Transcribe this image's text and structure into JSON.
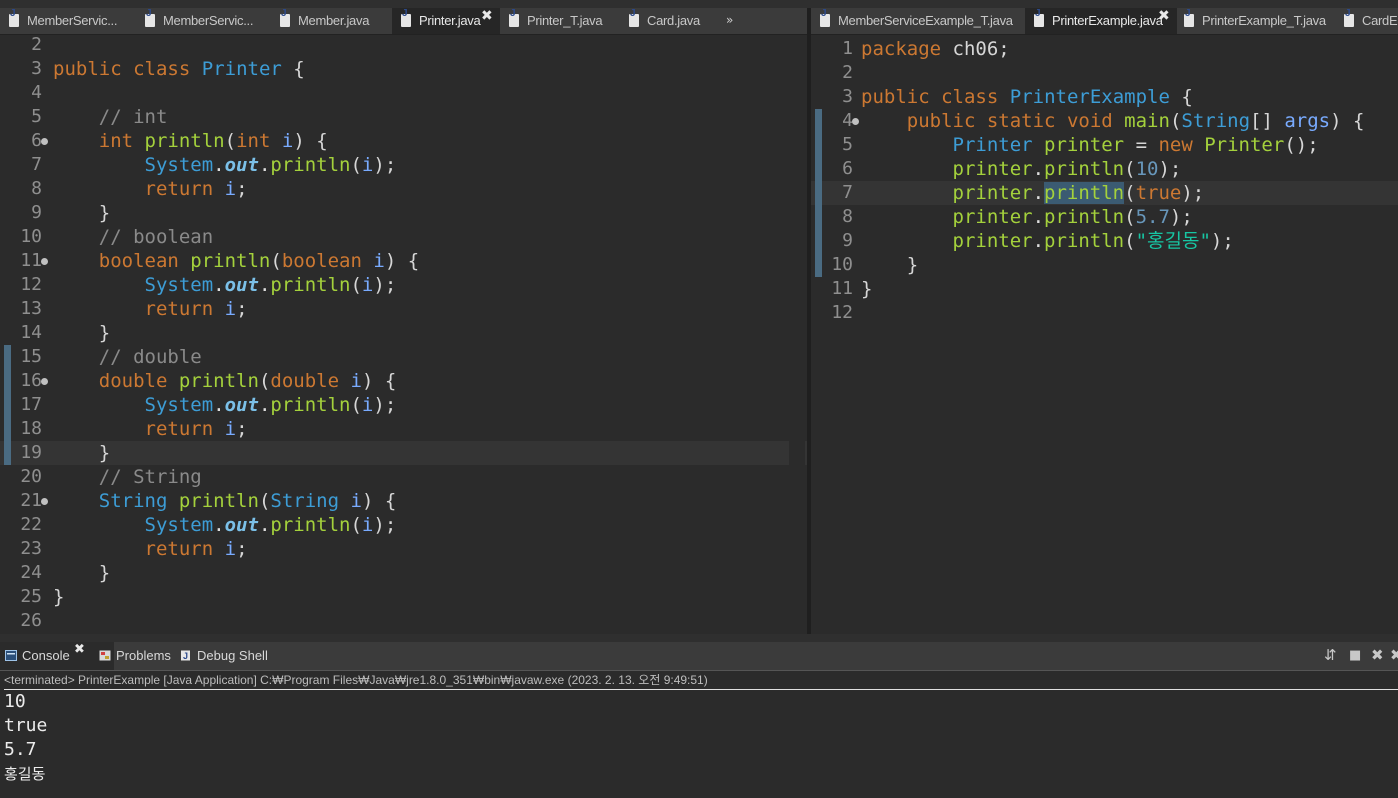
{
  "left_tabs": [
    {
      "label": "MemberServic...",
      "active": false
    },
    {
      "label": "MemberServic...",
      "active": false
    },
    {
      "label": "Member.java",
      "active": false
    },
    {
      "label": "Printer.java",
      "active": true
    },
    {
      "label": "Printer_T.java",
      "active": false
    },
    {
      "label": "Card.java",
      "active": false
    }
  ],
  "left_overflow": "»",
  "right_tabs": [
    {
      "label": "MemberServiceExample_T.java",
      "active": false
    },
    {
      "label": "PrinterExample.java",
      "active": true
    },
    {
      "label": "PrinterExample_T.java",
      "active": false
    },
    {
      "label": "CardE",
      "active": false
    }
  ],
  "close_glyph": "✖",
  "left_editor": {
    "lines": [
      {
        "n": "2",
        "tokens": []
      },
      {
        "n": "3",
        "tokens": [
          [
            "kw",
            "public"
          ],
          [
            "plain",
            " "
          ],
          [
            "kw",
            "class"
          ],
          [
            "plain",
            " "
          ],
          [
            "ty",
            "Printer"
          ],
          [
            "plain",
            " {"
          ]
        ]
      },
      {
        "n": "4",
        "tokens": []
      },
      {
        "n": "5",
        "tokens": [
          [
            "plain",
            "    "
          ],
          [
            "cm",
            "// int"
          ]
        ]
      },
      {
        "n": "6",
        "fold": true,
        "tokens": [
          [
            "plain",
            "    "
          ],
          [
            "kw",
            "int"
          ],
          [
            "plain",
            " "
          ],
          [
            "fn",
            "println"
          ],
          [
            "plain",
            "("
          ],
          [
            "kw",
            "int"
          ],
          [
            "plain",
            " "
          ],
          [
            "va",
            "i"
          ],
          [
            "plain",
            ") {"
          ]
        ]
      },
      {
        "n": "7",
        "tokens": [
          [
            "plain",
            "        "
          ],
          [
            "ty",
            "System"
          ],
          [
            "dot",
            "."
          ],
          [
            "fld",
            "out"
          ],
          [
            "dot",
            "."
          ],
          [
            "fn",
            "println"
          ],
          [
            "plain",
            "("
          ],
          [
            "va",
            "i"
          ],
          [
            "plain",
            ");"
          ]
        ]
      },
      {
        "n": "8",
        "tokens": [
          [
            "plain",
            "        "
          ],
          [
            "kw",
            "return"
          ],
          [
            "plain",
            " "
          ],
          [
            "va",
            "i"
          ],
          [
            "plain",
            ";"
          ]
        ]
      },
      {
        "n": "9",
        "tokens": [
          [
            "plain",
            "    }"
          ]
        ]
      },
      {
        "n": "10",
        "tokens": [
          [
            "plain",
            "    "
          ],
          [
            "cm",
            "// boolean"
          ]
        ]
      },
      {
        "n": "11",
        "fold": true,
        "tokens": [
          [
            "plain",
            "    "
          ],
          [
            "kw",
            "boolean"
          ],
          [
            "plain",
            " "
          ],
          [
            "fn",
            "println"
          ],
          [
            "plain",
            "("
          ],
          [
            "kw",
            "boolean"
          ],
          [
            "plain",
            " "
          ],
          [
            "va",
            "i"
          ],
          [
            "plain",
            ") {"
          ]
        ]
      },
      {
        "n": "12",
        "tokens": [
          [
            "plain",
            "        "
          ],
          [
            "ty",
            "System"
          ],
          [
            "dot",
            "."
          ],
          [
            "fld",
            "out"
          ],
          [
            "dot",
            "."
          ],
          [
            "fn",
            "println"
          ],
          [
            "plain",
            "("
          ],
          [
            "va",
            "i"
          ],
          [
            "plain",
            ");"
          ]
        ]
      },
      {
        "n": "13",
        "tokens": [
          [
            "plain",
            "        "
          ],
          [
            "kw",
            "return"
          ],
          [
            "plain",
            " "
          ],
          [
            "va",
            "i"
          ],
          [
            "plain",
            ";"
          ]
        ]
      },
      {
        "n": "14",
        "tokens": [
          [
            "plain",
            "    }"
          ]
        ]
      },
      {
        "n": "15",
        "tokens": [
          [
            "plain",
            "    "
          ],
          [
            "cm",
            "// double"
          ]
        ]
      },
      {
        "n": "16",
        "fold": true,
        "tokens": [
          [
            "plain",
            "    "
          ],
          [
            "kw",
            "double"
          ],
          [
            "plain",
            " "
          ],
          [
            "fn",
            "println"
          ],
          [
            "plain",
            "("
          ],
          [
            "kw",
            "double"
          ],
          [
            "plain",
            " "
          ],
          [
            "va",
            "i"
          ],
          [
            "plain",
            ") {"
          ]
        ]
      },
      {
        "n": "17",
        "tokens": [
          [
            "plain",
            "        "
          ],
          [
            "ty",
            "System"
          ],
          [
            "dot",
            "."
          ],
          [
            "fld",
            "out"
          ],
          [
            "dot",
            "."
          ],
          [
            "fn",
            "println"
          ],
          [
            "plain",
            "("
          ],
          [
            "va",
            "i"
          ],
          [
            "plain",
            ");"
          ]
        ]
      },
      {
        "n": "18",
        "tokens": [
          [
            "plain",
            "        "
          ],
          [
            "kw",
            "return"
          ],
          [
            "plain",
            " "
          ],
          [
            "va",
            "i"
          ],
          [
            "plain",
            ";"
          ]
        ]
      },
      {
        "n": "19",
        "current": true,
        "tokens": [
          [
            "plain",
            "    }"
          ]
        ]
      },
      {
        "n": "20",
        "tokens": [
          [
            "plain",
            "    "
          ],
          [
            "cm",
            "// String"
          ]
        ]
      },
      {
        "n": "21",
        "fold": true,
        "tokens": [
          [
            "plain",
            "    "
          ],
          [
            "ty",
            "String"
          ],
          [
            "plain",
            " "
          ],
          [
            "fn",
            "println"
          ],
          [
            "plain",
            "("
          ],
          [
            "ty",
            "String"
          ],
          [
            "plain",
            " "
          ],
          [
            "va",
            "i"
          ],
          [
            "plain",
            ") {"
          ]
        ]
      },
      {
        "n": "22",
        "tokens": [
          [
            "plain",
            "        "
          ],
          [
            "ty",
            "System"
          ],
          [
            "dot",
            "."
          ],
          [
            "fld",
            "out"
          ],
          [
            "dot",
            "."
          ],
          [
            "fn",
            "println"
          ],
          [
            "plain",
            "("
          ],
          [
            "va",
            "i"
          ],
          [
            "plain",
            ");"
          ]
        ]
      },
      {
        "n": "23",
        "tokens": [
          [
            "plain",
            "        "
          ],
          [
            "kw",
            "return"
          ],
          [
            "plain",
            " "
          ],
          [
            "va",
            "i"
          ],
          [
            "plain",
            ";"
          ]
        ]
      },
      {
        "n": "24",
        "tokens": [
          [
            "plain",
            "    }"
          ]
        ]
      },
      {
        "n": "25",
        "tokens": [
          [
            "plain",
            "}"
          ]
        ]
      },
      {
        "n": "26",
        "tokens": []
      }
    ]
  },
  "right_editor": {
    "lines": [
      {
        "n": "1",
        "tokens": [
          [
            "kw",
            "package"
          ],
          [
            "plain",
            " ch06;"
          ]
        ]
      },
      {
        "n": "2",
        "tokens": []
      },
      {
        "n": "3",
        "tokens": [
          [
            "kw",
            "public"
          ],
          [
            "plain",
            " "
          ],
          [
            "kw",
            "class"
          ],
          [
            "plain",
            " "
          ],
          [
            "ty",
            "PrinterExample"
          ],
          [
            "plain",
            " {"
          ]
        ]
      },
      {
        "n": "4",
        "fold": true,
        "tokens": [
          [
            "plain",
            "    "
          ],
          [
            "kw",
            "public"
          ],
          [
            "plain",
            " "
          ],
          [
            "kw",
            "static"
          ],
          [
            "plain",
            " "
          ],
          [
            "kw",
            "void"
          ],
          [
            "plain",
            " "
          ],
          [
            "fn",
            "main"
          ],
          [
            "plain",
            "("
          ],
          [
            "ty",
            "String"
          ],
          [
            "plain",
            "[] "
          ],
          [
            "va",
            "args"
          ],
          [
            "plain",
            ") {"
          ]
        ]
      },
      {
        "n": "5",
        "tokens": [
          [
            "plain",
            "        "
          ],
          [
            "ty",
            "Printer"
          ],
          [
            "plain",
            " "
          ],
          [
            "fn",
            "printer"
          ],
          [
            "plain",
            " = "
          ],
          [
            "kw",
            "new"
          ],
          [
            "plain",
            " "
          ],
          [
            "fn",
            "Printer"
          ],
          [
            "plain",
            "();"
          ]
        ]
      },
      {
        "n": "6",
        "tokens": [
          [
            "plain",
            "        "
          ],
          [
            "fn",
            "printer"
          ],
          [
            "dot",
            "."
          ],
          [
            "fn",
            "println"
          ],
          [
            "plain",
            "("
          ],
          [
            "num",
            "10"
          ],
          [
            "plain",
            ");"
          ]
        ]
      },
      {
        "n": "7",
        "current": true,
        "tokens": [
          [
            "plain",
            "        "
          ],
          [
            "fn",
            "printer"
          ],
          [
            "dot",
            "."
          ],
          [
            "hl",
            "println"
          ],
          [
            "plain",
            "("
          ],
          [
            "kw",
            "true"
          ],
          [
            "plain",
            ");"
          ]
        ]
      },
      {
        "n": "8",
        "tokens": [
          [
            "plain",
            "        "
          ],
          [
            "fn",
            "printer"
          ],
          [
            "dot",
            "."
          ],
          [
            "fn",
            "println"
          ],
          [
            "plain",
            "("
          ],
          [
            "num",
            "5.7"
          ],
          [
            "plain",
            ");"
          ]
        ]
      },
      {
        "n": "9",
        "tokens": [
          [
            "plain",
            "        "
          ],
          [
            "fn",
            "printer"
          ],
          [
            "dot",
            "."
          ],
          [
            "fn",
            "println"
          ],
          [
            "plain",
            "("
          ],
          [
            "st",
            "\"홍길동\""
          ],
          [
            "plain",
            ");"
          ]
        ]
      },
      {
        "n": "10",
        "tokens": [
          [
            "plain",
            "    }"
          ]
        ]
      },
      {
        "n": "11",
        "tokens": [
          [
            "plain",
            "}"
          ]
        ]
      },
      {
        "n": "12",
        "tokens": []
      }
    ]
  },
  "console": {
    "tabs": [
      {
        "label": "Console",
        "active": true,
        "icon": "console-icon"
      },
      {
        "label": "Problems",
        "active": false,
        "icon": "problems-icon"
      },
      {
        "label": "Debug Shell",
        "active": false,
        "icon": "debug-shell-icon"
      }
    ],
    "terminated_line": "<terminated> PrinterExample [Java Application] C:₩Program Files₩Java₩jre1.8.0_351₩bin₩javaw.exe (2023. 2. 13. 오전 9:49:51)",
    "output": [
      "10",
      "true",
      "5.7",
      "홍길동"
    ]
  }
}
